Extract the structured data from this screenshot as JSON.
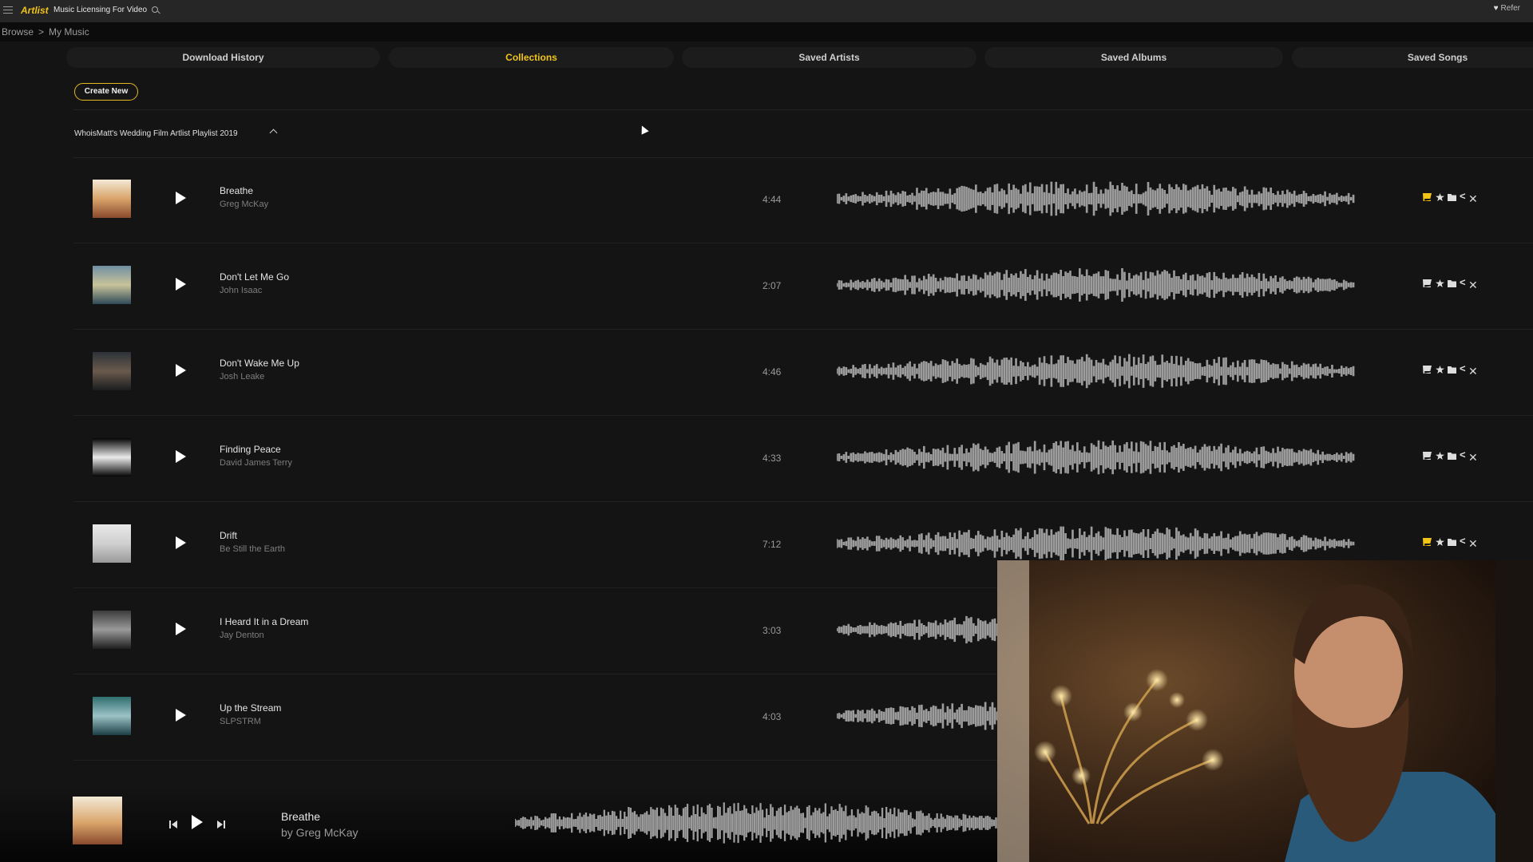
{
  "topbar": {
    "brand": "Artlist",
    "site_title": "Music Licensing For Video",
    "refer_label": "Refer",
    "icons": [
      "hamburger-menu-icon",
      "search-icon",
      "heart-icon"
    ]
  },
  "breadcrumb": {
    "items": [
      "Browse",
      ">",
      "My Music"
    ]
  },
  "tabs": [
    {
      "label": "Download History",
      "active": false
    },
    {
      "label": "Collections",
      "active": true
    },
    {
      "label": "Saved Artists",
      "active": false
    },
    {
      "label": "Saved Albums",
      "active": false
    },
    {
      "label": "Saved Songs",
      "active": false
    }
  ],
  "create_new_label": "Create New",
  "playlist": {
    "title": "WhoisMatt's Wedding Film Artlist Playlist 2019",
    "tracks": [
      {
        "title": "Breathe",
        "artist": "Greg McKay",
        "duration": "4:44",
        "in_cart": true
      },
      {
        "title": "Don't Let Me Go",
        "artist": "John Isaac",
        "duration": "2:07",
        "in_cart": false
      },
      {
        "title": "Don't Wake Me Up",
        "artist": "Josh Leake",
        "duration": "4:46",
        "in_cart": false
      },
      {
        "title": "Finding Peace",
        "artist": "David James Terry",
        "duration": "4:33",
        "in_cart": false
      },
      {
        "title": "Drift",
        "artist": "Be Still the Earth",
        "duration": "7:12",
        "in_cart": true
      },
      {
        "title": "I Heard It in a Dream",
        "artist": "Jay Denton",
        "duration": "3:03",
        "in_cart": false
      },
      {
        "title": "Up the Stream",
        "artist": "SLPSTRM",
        "duration": "4:03",
        "in_cart": false
      }
    ]
  },
  "player": {
    "title": "Breathe",
    "artist": "by Greg McKay"
  },
  "colors": {
    "accent": "#f0c419",
    "background": "#141414",
    "topbar": "#262626"
  }
}
